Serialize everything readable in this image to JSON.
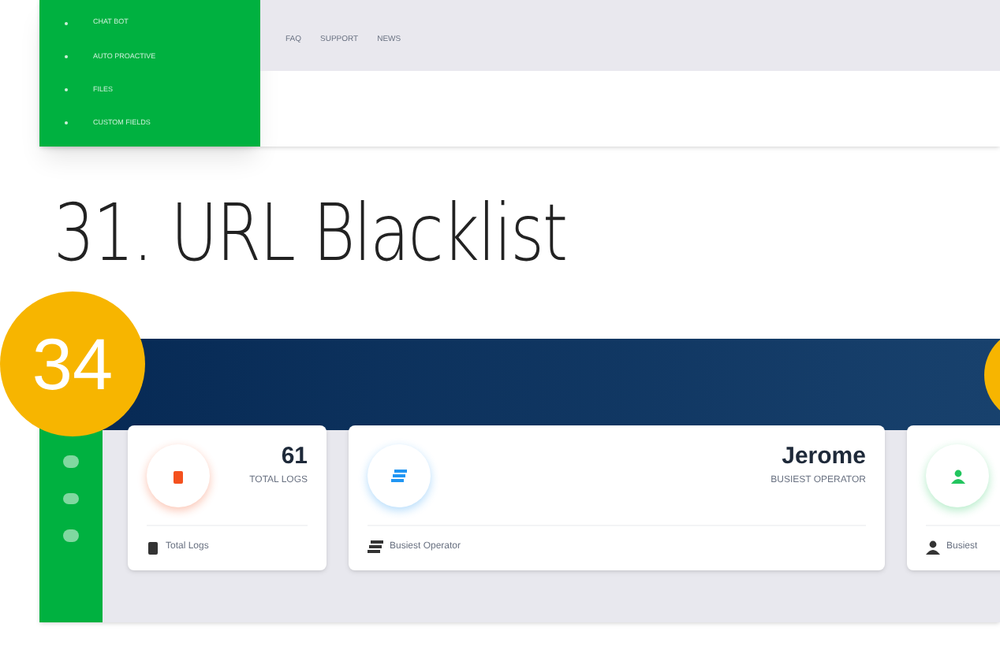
{
  "top_screenshot": {
    "sidebar_items": [
      "CHAT BOT",
      "AUTO PROACTIVE",
      "FILES",
      "CUSTOM FIELDS"
    ],
    "nav_links": [
      "FAQ",
      "SUPPORT",
      "NEWS"
    ]
  },
  "heading": "31. URL Blacklist",
  "step_badge": "34",
  "dashboard": {
    "cards": [
      {
        "kind": "logs",
        "value": "61",
        "caption": "TOTAL LOGS",
        "footer": "Total Logs",
        "color": "#f4511e"
      },
      {
        "kind": "operator",
        "value": "Jerome",
        "caption": "BUSIEST OPERATOR",
        "footer": "Busiest Operator",
        "color": "#2196f3"
      },
      {
        "kind": "user",
        "footer": "Busiest",
        "color": "#22c55e"
      }
    ]
  }
}
